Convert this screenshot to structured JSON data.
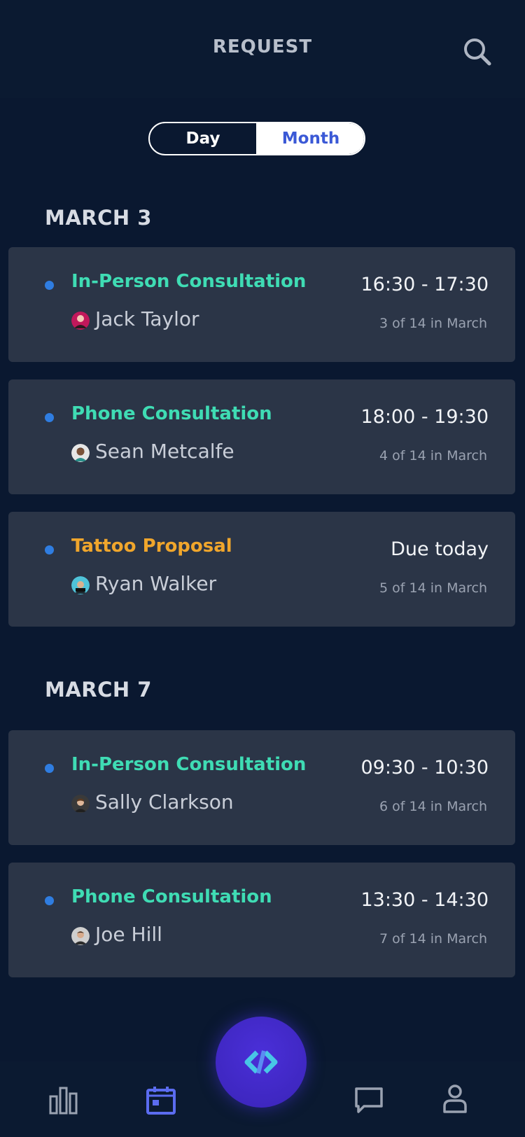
{
  "header": {
    "title": "REQUEST",
    "search_icon": "search-icon"
  },
  "view_toggle": {
    "options": [
      "Day",
      "Month"
    ],
    "selected": "Month"
  },
  "sections": [
    {
      "date": "MARCH 3",
      "items": [
        {
          "title": "In-Person Consultation",
          "title_color": "#3fdcb4",
          "person": "Jack Taylor",
          "time": "16:30 - 17:30",
          "count": "3 of 14 in March"
        },
        {
          "title": "Phone Consultation",
          "title_color": "#3fdcb4",
          "person": "Sean Metcalfe",
          "time": "18:00 - 19:30",
          "count": "4 of 14 in March"
        },
        {
          "title": "Tattoo Proposal",
          "title_color": "#f0a62c",
          "person": "Ryan Walker",
          "time": "Due today",
          "count": "5 of 14 in March"
        }
      ]
    },
    {
      "date": "MARCH 7",
      "items": [
        {
          "title": "In-Person Consultation",
          "title_color": "#3fdcb4",
          "person": "Sally Clarkson",
          "time": "09:30 - 10:30",
          "count": "6 of 14 in March"
        },
        {
          "title": "Phone Consultation",
          "title_color": "#3fdcb4",
          "person": "Joe Hill",
          "time": "13:30 - 14:30",
          "count": "7 of 14 in March"
        }
      ]
    }
  ],
  "tabbar": {
    "tabs": [
      "bar-chart-icon",
      "calendar-icon",
      "chat-icon",
      "profile-icon"
    ],
    "active": "calendar-icon",
    "fab_icon": "brand-logo-icon"
  },
  "colors": {
    "background": "#0a1830",
    "card": "#2b3547",
    "accent_green": "#3fdcb4",
    "accent_orange": "#f0a62c",
    "dot_blue": "#2f7de1",
    "active_tab": "#5b6cf0"
  }
}
